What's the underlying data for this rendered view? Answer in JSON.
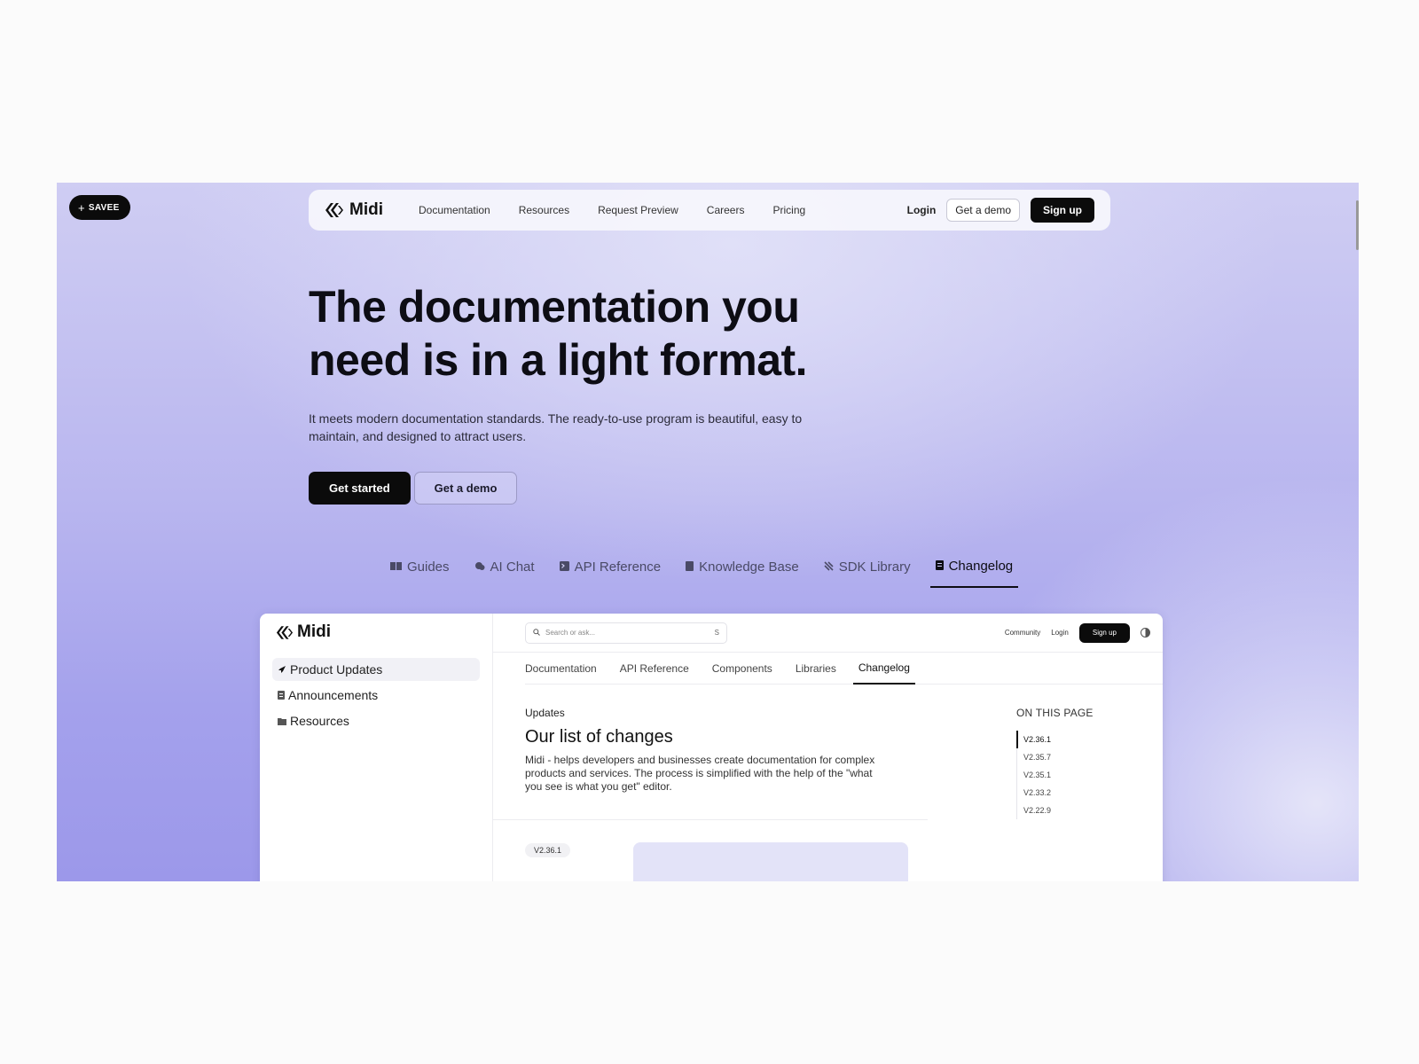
{
  "savee": {
    "label": "SAVEE"
  },
  "nav": {
    "brand": "Midi",
    "links": [
      "Documentation",
      "Resources",
      "Request Preview",
      "Careers",
      "Pricing"
    ],
    "login": "Login",
    "demo": "Get a demo",
    "signup": "Sign up"
  },
  "hero": {
    "title_line1": "The documentation you",
    "title_line2": "need is in a light format.",
    "description": "It meets modern documentation standards. The ready-to-use program is beautiful, easy to maintain, and designed to attract users.",
    "cta_primary": "Get started",
    "cta_secondary": "Get a demo"
  },
  "product_tabs": [
    {
      "label": "Guides",
      "icon": "book-icon"
    },
    {
      "label": "AI Chat",
      "icon": "chat-icon"
    },
    {
      "label": "API Reference",
      "icon": "terminal-icon"
    },
    {
      "label": "Knowledge Base",
      "icon": "notebook-icon"
    },
    {
      "label": "SDK Library",
      "icon": "sdk-icon"
    },
    {
      "label": "Changelog",
      "icon": "changelog-icon",
      "active": true
    }
  ],
  "app": {
    "brand": "Midi",
    "sidebar": [
      {
        "label": "Product Updates",
        "icon": "rocket-icon",
        "active": true
      },
      {
        "label": "Announcements",
        "icon": "document-icon"
      },
      {
        "label": "Resources",
        "icon": "folder-icon"
      }
    ],
    "search": {
      "placeholder": "Search or ask...",
      "shortcut": "S"
    },
    "top_right": {
      "community": "Community",
      "login": "Login",
      "signup": "Sign up"
    },
    "tabs": [
      "Documentation",
      "API Reference",
      "Components",
      "Libraries",
      "Changelog"
    ],
    "active_tab": "Changelog",
    "content": {
      "eyebrow": "Updates",
      "title": "Our list of changes",
      "body": "Midi - helps developers and businesses create documentation for complex products and services. The process is simplified with the help of the \"what you see is what you get\" editor.",
      "version_tag": "V2.36.1"
    },
    "toc": {
      "title": "ON THIS PAGE",
      "items": [
        "V2.36.1",
        "V2.35.7",
        "V2.35.1",
        "V2.33.2",
        "V2.22.9"
      ],
      "active": "V2.36.1"
    }
  },
  "colors": {
    "accent": "#0b0b0b",
    "background_top": "#cfcdf3",
    "background_bottom": "#9c98ea"
  }
}
